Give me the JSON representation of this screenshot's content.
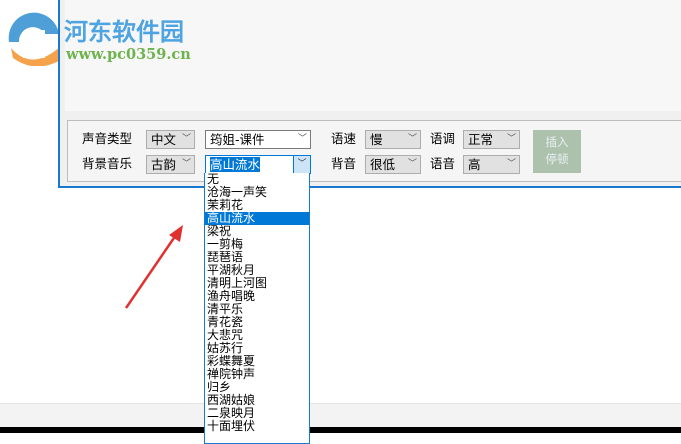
{
  "watermark": {
    "title": "河东软件园",
    "url": "www.pc0359.cn"
  },
  "panel": {
    "voice_type_label": "声音类型",
    "voice_type_value": "中文",
    "voice_name_value": "筠姐-课件",
    "bg_music_label": "背景音乐",
    "bg_music_style": "古韵",
    "bg_music_value": "高山流水",
    "speed_label": "语速",
    "speed_value": "慢",
    "tone_label": "语调",
    "tone_value": "正常",
    "bg_volume_label": "背音",
    "bg_volume_value": "很低",
    "voice_volume_label": "语音",
    "voice_volume_value": "高",
    "insert_pause_line1": "插入",
    "insert_pause_line2": "停顿"
  },
  "dropdown": {
    "selected": "高山流水",
    "items": [
      "无",
      "沧海一声笑",
      "茉莉花",
      "高山流水",
      "梁祝",
      "一剪梅",
      "琵琶语",
      "平湖秋月",
      "清明上河图",
      "渔舟唱晚",
      "清平乐",
      "青花瓷",
      "大悲咒",
      "姑苏行",
      "彩蝶舞夏",
      "禅院钟声",
      "归乡",
      "西湖姑娘",
      "二泉映月",
      "十面埋伏"
    ]
  },
  "colors": {
    "accent": "#0078d7",
    "button": "#adc2ad",
    "arrow": "#e0302f"
  }
}
